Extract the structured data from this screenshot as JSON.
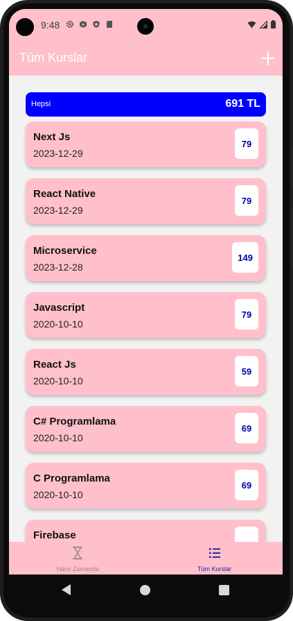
{
  "status_bar": {
    "time": "9:48",
    "icons": [
      "gear-icon",
      "aperture-icon",
      "shield-icon",
      "sd-card-icon"
    ],
    "right_icons": [
      "wifi-icon",
      "signal-icon",
      "battery-icon"
    ]
  },
  "app_bar": {
    "title": "Tüm Kurslar",
    "action_icon": "plus-icon"
  },
  "summary": {
    "label": "Hepsi",
    "total": "691 TL",
    "color": "#0000ff"
  },
  "courses": [
    {
      "name": "Next Js",
      "date": "2023-12-29",
      "price": "79"
    },
    {
      "name": "React Native",
      "date": "2023-12-29",
      "price": "79"
    },
    {
      "name": "Microservice",
      "date": "2023-12-28",
      "price": "149"
    },
    {
      "name": "Javascript",
      "date": "2020-10-10",
      "price": "79"
    },
    {
      "name": "React Js",
      "date": "2020-10-10",
      "price": "59"
    },
    {
      "name": "C# Programlama",
      "date": "2020-10-10",
      "price": "69"
    },
    {
      "name": "C Programlama",
      "date": "2020-10-10",
      "price": "69"
    },
    {
      "name": "Firebase",
      "date": "",
      "price": ""
    }
  ],
  "bottom_nav": {
    "tabs": [
      {
        "label": "Yakın Zamanda",
        "icon": "hourglass-icon",
        "active": false
      },
      {
        "label": "Tüm Kurslar",
        "icon": "list-icon",
        "active": true
      }
    ]
  },
  "colors": {
    "accent": "#ffc0cb",
    "active_tab": "#1a1aa0",
    "price_text": "#0000aa",
    "background": "#f2f2f2"
  }
}
